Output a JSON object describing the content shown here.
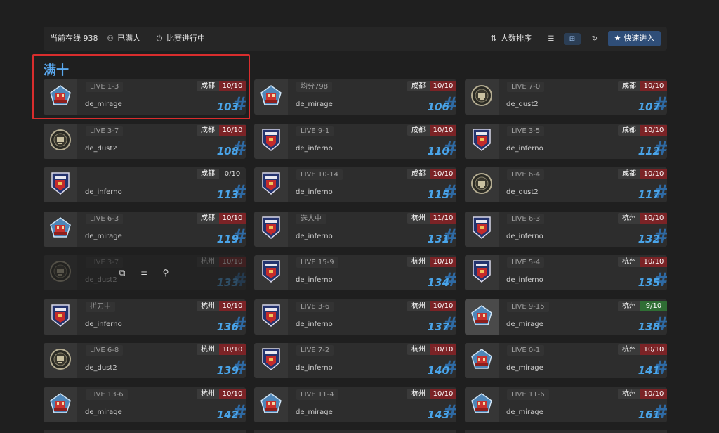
{
  "header": {
    "online_label": "当前在线 938",
    "full_label": "已满人",
    "in_progress_label": "比赛进行中",
    "sort_label": "人数排序",
    "quick_join_label": "快速进入"
  },
  "group_title": "满十",
  "hover_tools": [
    "copy-icon",
    "list-icon",
    "link-icon"
  ],
  "rooms": [
    {
      "tag": "LIVE 1-3",
      "map": "de_mirage",
      "city": "成都",
      "count": "10/10",
      "number": "103",
      "icon": "mirage-emblem-icon",
      "status": "full"
    },
    {
      "tag": "均分798",
      "map": "de_mirage",
      "city": "成都",
      "count": "10/10",
      "number": "106",
      "icon": "mirage-emblem-icon",
      "status": "full"
    },
    {
      "tag": "LIVE 7-0",
      "map": "de_dust2",
      "city": "成都",
      "count": "10/10",
      "number": "107",
      "icon": "dust2-emblem-icon",
      "status": "full"
    },
    {
      "tag": "LIVE 3-7",
      "map": "de_dust2",
      "city": "成都",
      "count": "10/10",
      "number": "108",
      "icon": "dust2-emblem-icon",
      "status": "full"
    },
    {
      "tag": "LIVE 9-1",
      "map": "de_inferno",
      "city": "成都",
      "count": "10/10",
      "number": "110",
      "icon": "inferno-emblem-icon",
      "status": "full"
    },
    {
      "tag": "LIVE 3-5",
      "map": "de_inferno",
      "city": "成都",
      "count": "10/10",
      "number": "112",
      "icon": "inferno-emblem-icon",
      "status": "full"
    },
    {
      "tag": "",
      "map": "de_inferno",
      "city": "成都",
      "count": "0/10",
      "number": "113",
      "icon": "inferno-emblem-icon",
      "status": "partial"
    },
    {
      "tag": "LIVE 10-14",
      "map": "de_inferno",
      "city": "成都",
      "count": "10/10",
      "number": "115",
      "icon": "inferno-emblem-icon",
      "status": "full"
    },
    {
      "tag": "LIVE 6-4",
      "map": "de_dust2",
      "city": "成都",
      "count": "10/10",
      "number": "117",
      "icon": "dust2-emblem-icon",
      "status": "full"
    },
    {
      "tag": "LIVE 6-3",
      "map": "de_mirage",
      "city": "成都",
      "count": "10/10",
      "number": "119",
      "icon": "mirage-emblem-icon",
      "status": "full"
    },
    {
      "tag": "选人中",
      "map": "de_inferno",
      "city": "杭州",
      "count": "11/10",
      "number": "131",
      "icon": "inferno-emblem-icon",
      "status": "full"
    },
    {
      "tag": "LIVE 6-3",
      "map": "de_inferno",
      "city": "杭州",
      "count": "10/10",
      "number": "132",
      "icon": "inferno-emblem-icon",
      "status": "full"
    },
    {
      "tag": "LIVE 3-7",
      "map": "de_dust2",
      "city": "杭州",
      "count": "10/10",
      "number": "133",
      "icon": "dust2-emblem-icon",
      "status": "full"
    },
    {
      "tag": "LIVE 15-9",
      "map": "de_inferno",
      "city": "杭州",
      "count": "10/10",
      "number": "134",
      "icon": "inferno-emblem-icon",
      "status": "full"
    },
    {
      "tag": "LIVE 5-4",
      "map": "de_inferno",
      "city": "杭州",
      "count": "10/10",
      "number": "135",
      "icon": "inferno-emblem-icon",
      "status": "full"
    },
    {
      "tag": "拼刀中",
      "map": "de_inferno",
      "city": "杭州",
      "count": "10/10",
      "number": "136",
      "icon": "inferno-emblem-icon",
      "status": "full"
    },
    {
      "tag": "LIVE 3-6",
      "map": "de_inferno",
      "city": "杭州",
      "count": "10/10",
      "number": "137",
      "icon": "inferno-emblem-icon",
      "status": "full"
    },
    {
      "tag": "LIVE 9-15",
      "map": "de_mirage",
      "city": "杭州",
      "count": "9/10",
      "number": "138",
      "icon": "mirage-emblem-icon",
      "status": "ok"
    },
    {
      "tag": "LIVE 6-8",
      "map": "de_dust2",
      "city": "杭州",
      "count": "10/10",
      "number": "139",
      "icon": "dust2-emblem-icon",
      "status": "full"
    },
    {
      "tag": "LIVE 7-2",
      "map": "de_inferno",
      "city": "杭州",
      "count": "10/10",
      "number": "140",
      "icon": "inferno-emblem-icon",
      "status": "full"
    },
    {
      "tag": "LIVE 0-1",
      "map": "de_mirage",
      "city": "杭州",
      "count": "10/10",
      "number": "141",
      "icon": "mirage-emblem-icon",
      "status": "full"
    },
    {
      "tag": "LIVE 13-6",
      "map": "de_mirage",
      "city": "杭州",
      "count": "10/10",
      "number": "142",
      "icon": "mirage-emblem-icon",
      "status": "full"
    },
    {
      "tag": "LIVE 11-4",
      "map": "de_mirage",
      "city": "杭州",
      "count": "10/10",
      "number": "143",
      "icon": "mirage-emblem-icon",
      "status": "full"
    },
    {
      "tag": "LIVE 11-6",
      "map": "de_mirage",
      "city": "杭州",
      "count": "10/10",
      "number": "161",
      "icon": "mirage-emblem-icon",
      "status": "full"
    }
  ]
}
